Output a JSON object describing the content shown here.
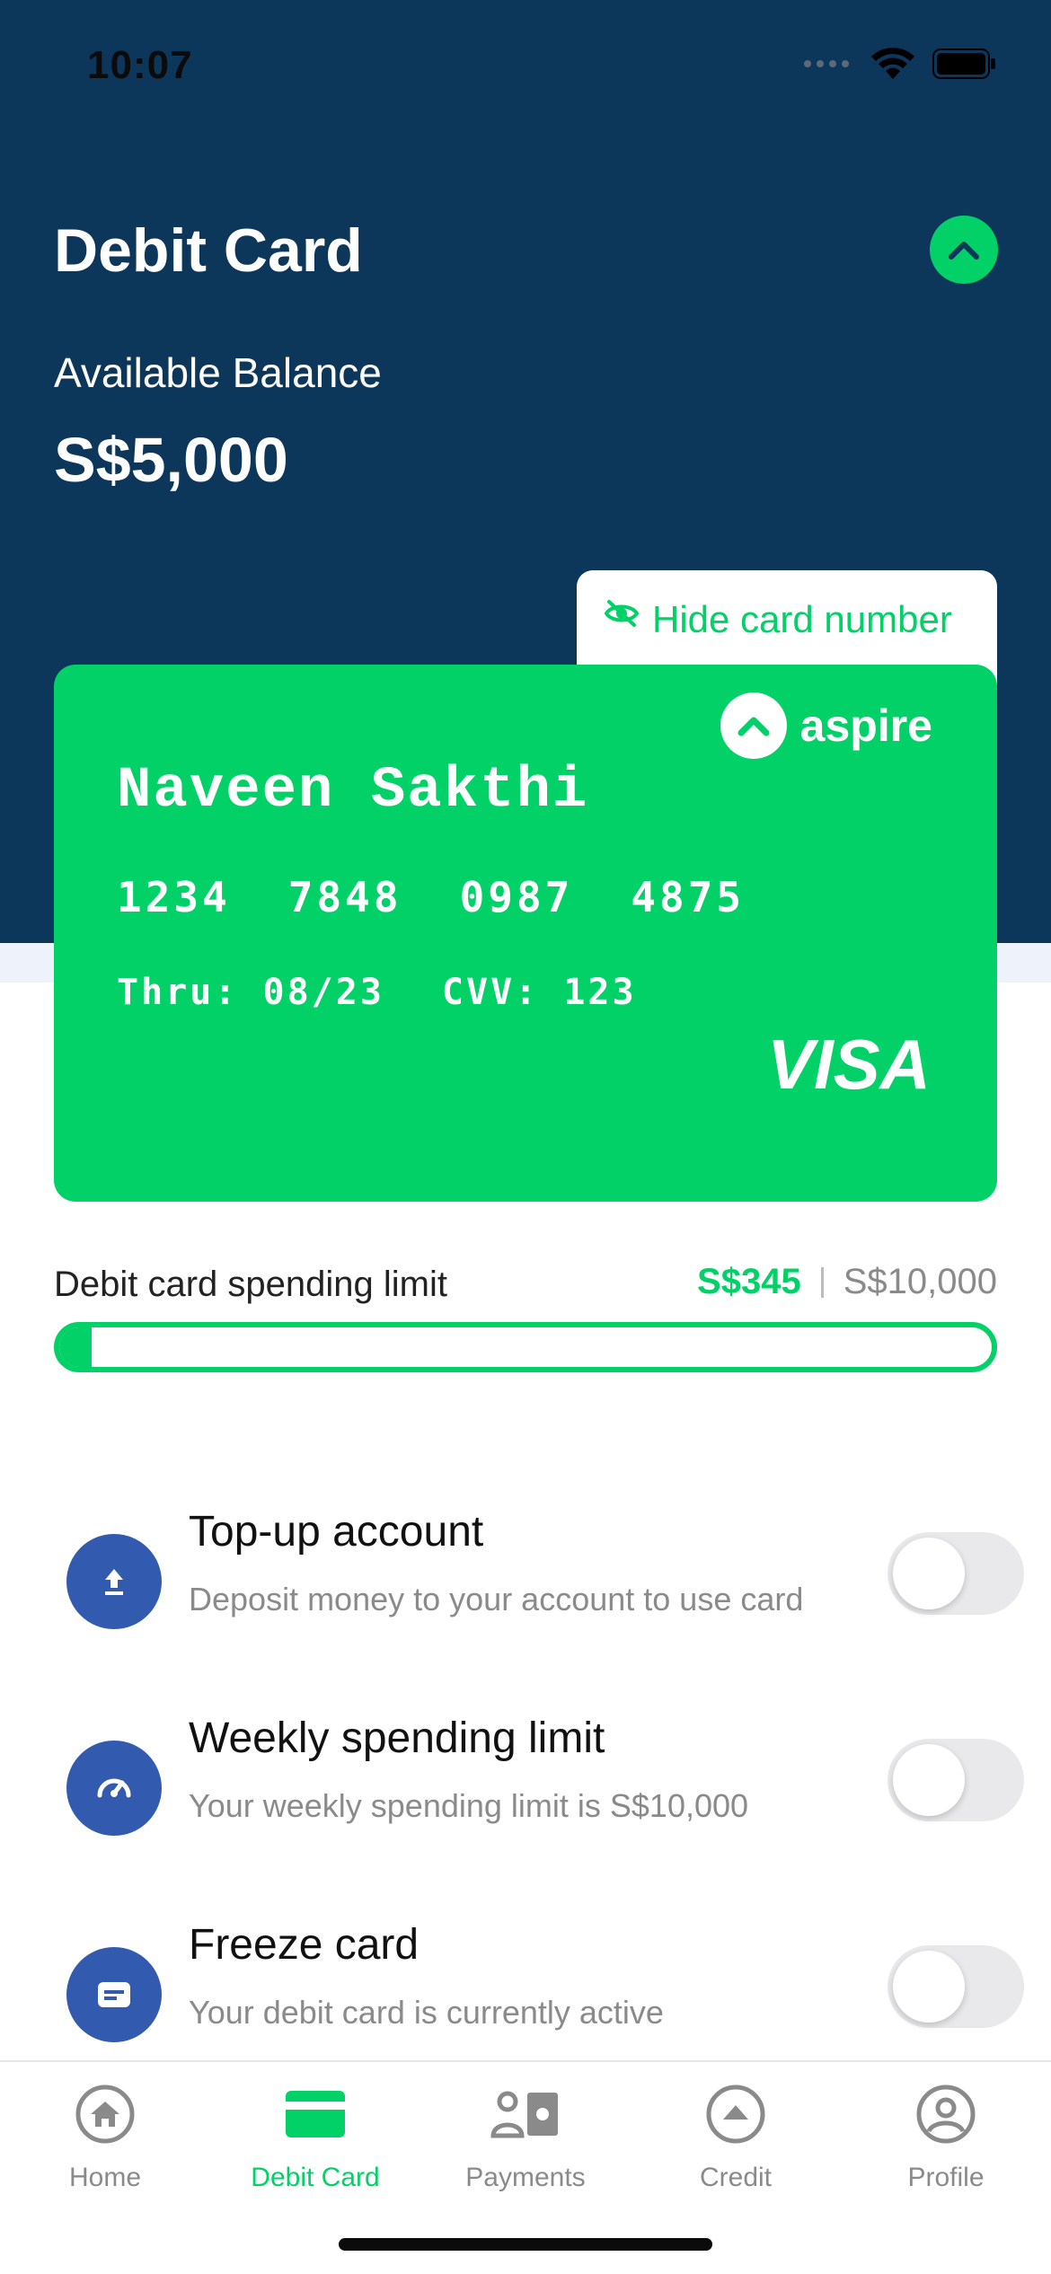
{
  "status_bar": {
    "time": "10:07"
  },
  "header": {
    "title": "Debit Card",
    "balance_label": "Available Balance",
    "balance_value": "S$5,000"
  },
  "card": {
    "hide_label": "Hide card number",
    "brand": "aspire",
    "holder": "Naveen Sakthi",
    "number_groups": [
      "1234",
      "7848",
      "0987",
      "4875"
    ],
    "thru": "Thru: 08/23",
    "cvv": "CVV: 123",
    "network": "VISA"
  },
  "spending_limit": {
    "label": "Debit card spending limit",
    "spent": "S$345",
    "total": "S$10,000",
    "fraction": 0.0345
  },
  "settings": [
    {
      "title": "Top-up account",
      "subtitle": "Deposit money to your account to use card",
      "icon": "upload-icon",
      "enabled": false
    },
    {
      "title": "Weekly spending limit",
      "subtitle": "Your weekly spending limit is S$10,000",
      "icon": "speedometer-icon",
      "enabled": false
    },
    {
      "title": "Freeze card",
      "subtitle": "Your debit card is currently active",
      "icon": "card-freeze-icon",
      "enabled": false
    }
  ],
  "tabs": [
    {
      "label": "Home",
      "icon": "home-icon",
      "active": false
    },
    {
      "label": "Debit Card",
      "icon": "card-icon",
      "active": true
    },
    {
      "label": "Payments",
      "icon": "payments-icon",
      "active": false
    },
    {
      "label": "Credit",
      "icon": "credit-icon",
      "active": false
    },
    {
      "label": "Profile",
      "icon": "profile-icon",
      "active": false
    }
  ],
  "colors": {
    "primary": "#0c365a",
    "accent": "#01d167",
    "icon_blue": "#325baf"
  }
}
